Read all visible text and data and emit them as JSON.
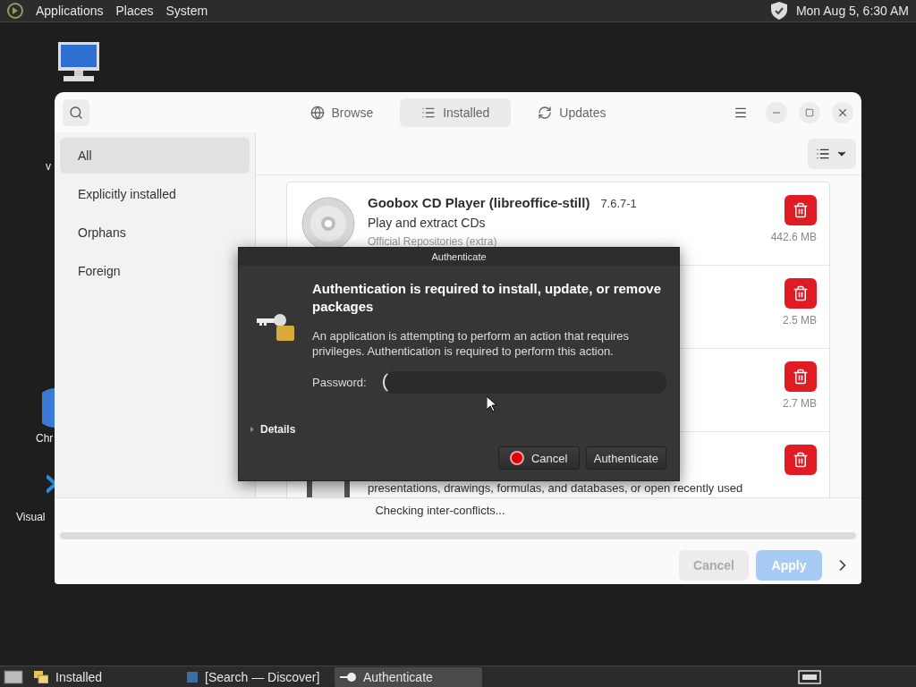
{
  "top_panel": {
    "menus": [
      "Applications",
      "Places",
      "System"
    ],
    "clock": "Mon Aug  5, 6:30 AM"
  },
  "desktop_icons": [
    {
      "kind": "computer"
    },
    {
      "kind": "vm",
      "label": "v"
    },
    {
      "kind": "chrome",
      "label": "Chr"
    },
    {
      "kind": "vscode",
      "label": "Visual"
    }
  ],
  "window": {
    "tabs": [
      {
        "label": "Browse",
        "selected": false
      },
      {
        "label": "Installed",
        "selected": true
      },
      {
        "label": "Updates",
        "selected": false
      }
    ],
    "sidebar": {
      "items": [
        {
          "label": "All",
          "selected": true
        },
        {
          "label": "Explicitly installed",
          "selected": false
        },
        {
          "label": "Orphans",
          "selected": false
        },
        {
          "label": "Foreign",
          "selected": false
        }
      ]
    },
    "packages": [
      {
        "name": "Goobox CD Player (libreoffice-still)",
        "version": "7.6.7-1",
        "description": "Play and extract CDs",
        "source": "Official Repositories (extra)",
        "size": "442.6 MB"
      },
      {
        "size": "2.5 MB"
      },
      {
        "size": "2.7 MB"
      },
      {
        "description": "presentations, drawings, formulas, and databases, or open recently used"
      }
    ],
    "status": "Checking inter-conflicts...",
    "progress": {
      "level": 0
    },
    "buttons": [
      {
        "label": "Cancel",
        "kind": "secondary",
        "disabled": true
      },
      {
        "label": "Apply",
        "kind": "primary",
        "disabled": true
      }
    ]
  },
  "dialog": {
    "title": "Authenticate",
    "heading": "Authentication is required to install, update, or remove packages",
    "message": "An application is attempting to perform an action that requires privileges. Authentication is required to perform this action.",
    "password_label": "Password:",
    "details": {
      "label": "Details",
      "expanded": false
    },
    "buttons": [
      {
        "label": "Cancel",
        "kind": "cancel"
      },
      {
        "label": "Authenticate",
        "kind": "default"
      }
    ]
  },
  "taskbar": {
    "items": [
      {
        "label": "Installed",
        "selected": false
      },
      {
        "label": "[Search — Discover]",
        "selected": false
      },
      {
        "label": "Authenticate",
        "selected": true
      }
    ]
  }
}
